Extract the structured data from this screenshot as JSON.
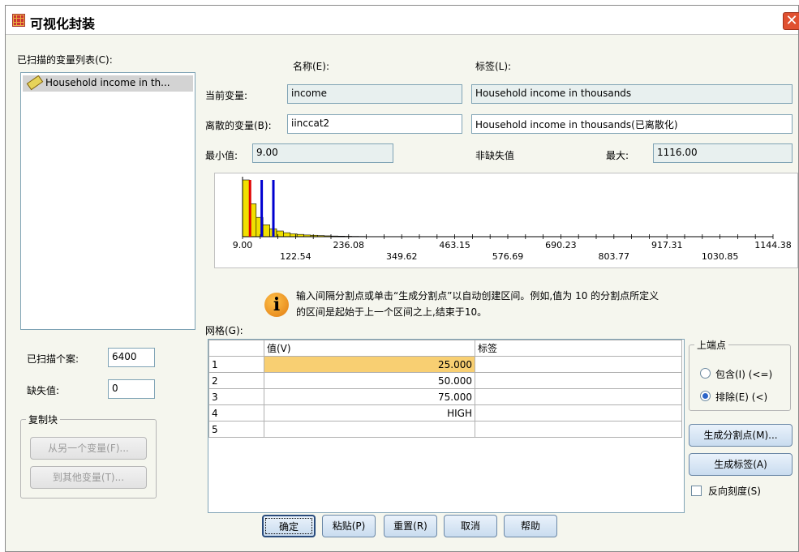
{
  "window": {
    "title": "可视化封装",
    "close_glyph": "✕"
  },
  "scanned_list": {
    "label": "已扫描的变量列表(C):",
    "items": [
      {
        "label": "Household income in th...",
        "icon": "ruler-icon"
      }
    ]
  },
  "headers": {
    "name": "名称(E):",
    "label": "标签(L):"
  },
  "current_var": {
    "label": "当前变量:",
    "name": "income",
    "var_label": "Household income in thousands"
  },
  "binned_var": {
    "label": "离散的变量(B):",
    "name": "iinccat2",
    "var_label": "Household income in thousands(已离散化)"
  },
  "stats": {
    "min_label": "最小值:",
    "min_value": "9.00",
    "nonmissing_label": "非缺失值",
    "max_label": "最大:",
    "max_value": "1116.00"
  },
  "histogram": {
    "axis_top_labels": [
      "9.00",
      "236.08",
      "463.15",
      "690.23",
      "917.31",
      "1144.38"
    ],
    "axis_bottom_labels": [
      "122.54",
      "349.62",
      "576.69",
      "803.77",
      "1030.85"
    ],
    "axis_min": 9.0,
    "axis_max": 1144.38,
    "bar_heights": [
      1.0,
      0.58,
      0.34,
      0.21,
      0.14,
      0.1,
      0.07,
      0.05,
      0.04,
      0.03,
      0.025,
      0.02,
      0.015,
      0.012,
      0.01,
      0.008,
      0.006,
      0.005
    ],
    "cutpoints": [
      {
        "value": 25,
        "color": "#e00000"
      },
      {
        "value": 50,
        "color": "#0000d0"
      },
      {
        "value": 75,
        "color": "#0000d0"
      }
    ]
  },
  "info": {
    "line1": "输入间隔分割点或单击“生成分割点”以自动创建区间。例如,值为 10 的分割点所定义",
    "line2": "的区间是起始于上一个区间之上,结束于10。"
  },
  "grid": {
    "label": "网格(G):",
    "col_value": "值(V)",
    "col_label": "标签",
    "rows": [
      {
        "n": "1",
        "value": "25.000",
        "label": ""
      },
      {
        "n": "2",
        "value": "50.000",
        "label": ""
      },
      {
        "n": "3",
        "value": "75.000",
        "label": ""
      },
      {
        "n": "4",
        "value": "HIGH",
        "label": ""
      },
      {
        "n": "5",
        "value": "",
        "label": ""
      }
    ]
  },
  "cases": {
    "scanned_label": "已扫描个案:",
    "scanned_value": "6400",
    "missing_label": "缺失值:",
    "missing_value": "0"
  },
  "copy_bins": {
    "legend": "复制块",
    "from_btn": "从另一个变量(F)...",
    "to_btn": "到其他变量(T)..."
  },
  "upper_endpoints": {
    "legend": "上端点",
    "include": "包含(I) (<=)",
    "exclude": "排除(E) (<)",
    "selected": "exclude"
  },
  "buttons": {
    "make_cutpoints": "生成分割点(M)...",
    "make_labels": "生成标签(A)",
    "reverse_scale": "反向刻度(S)",
    "ok": "确定",
    "paste": "粘贴(P)",
    "reset": "重置(R)",
    "cancel": "取消",
    "help": "帮助"
  }
}
